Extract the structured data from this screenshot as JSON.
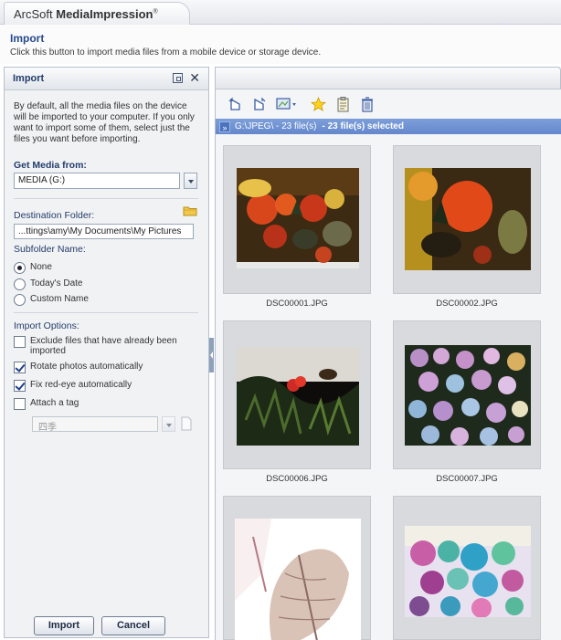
{
  "app": {
    "name_prefix": "ArcSoft ",
    "name_bold": "MediaImpression",
    "name_mark": "®"
  },
  "page": {
    "title": "Import",
    "description": "Click this button to import media files from a mobile device or storage device."
  },
  "panel": {
    "title": "Import",
    "intro": "By default, all the media files on the device will be imported to your computer. If you only want to import some of them, select just the files you want before importing.",
    "get_media_label": "Get Media from:",
    "media_value": "MEDIA (G:)",
    "destination_label": "Destination Folder:",
    "destination_value": "...ttings\\amy\\My Documents\\My Pictures",
    "subfolder_label": "Subfolder Name:",
    "subfolder_options": [
      {
        "label": "None",
        "selected": true
      },
      {
        "label": "Today's Date",
        "selected": false
      },
      {
        "label": "Custom Name",
        "selected": false
      }
    ],
    "import_options_label": "Import Options:",
    "options": [
      {
        "label": "Exclude files that have already been imported",
        "checked": false
      },
      {
        "label": "Rotate photos automatically",
        "checked": true
      },
      {
        "label": "Fix red-eye automatically",
        "checked": true
      },
      {
        "label": "Attach a tag",
        "checked": false
      }
    ],
    "tag_value": "四季",
    "import_button": "Import",
    "cancel_button": "Cancel"
  },
  "browser": {
    "path": "G:\\JPEG\\ - 23 file(s)",
    "selected": " - 23 file(s) selected",
    "toolbar_icons": [
      "rotate-left-icon",
      "rotate-right-icon",
      "view-mode-icon",
      "star-icon",
      "properties-icon",
      "delete-icon"
    ],
    "thumbnails": [
      {
        "filename": "DSC00001.JPG"
      },
      {
        "filename": "DSC00002.JPG"
      },
      {
        "filename": "DSC00006.JPG"
      },
      {
        "filename": "DSC00007.JPG"
      },
      {
        "filename": ""
      },
      {
        "filename": ""
      }
    ]
  },
  "colors": {
    "accent": "#6488cc",
    "heading": "#233d6b"
  }
}
